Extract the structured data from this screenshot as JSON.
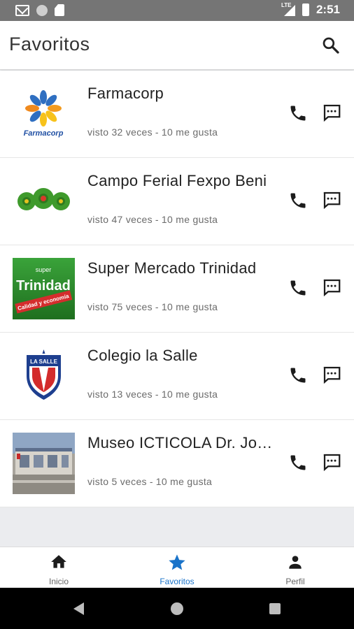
{
  "status_bar": {
    "time": "2:51",
    "network": "LTE"
  },
  "app_bar": {
    "title": "Favoritos"
  },
  "favorites": [
    {
      "name": "Farmacorp",
      "views": "visto 32 veces",
      "likes": "10 me gusta",
      "logo_text": "Farmacorp"
    },
    {
      "name": "Campo Ferial Fexpo Beni",
      "views": "visto 47 veces",
      "likes": "10 me gusta"
    },
    {
      "name": "Super Mercado Trinidad",
      "views": "visto 75 veces",
      "likes": "10 me gusta",
      "logo_text_1": "super",
      "logo_text_2": "Trinidad",
      "logo_text_3": "Calidad y economía"
    },
    {
      "name": "Colegio la Salle",
      "views": "visto 13 veces",
      "likes": "10 me gusta",
      "logo_text": "LA SALLE"
    },
    {
      "name": "Museo ICTICOLA Dr. Jorge",
      "views": "visto 5 veces",
      "likes": "10 me gusta"
    }
  ],
  "meta_separator": "-",
  "bottom_nav": {
    "items": [
      {
        "label": "Inicio",
        "icon": "home-icon"
      },
      {
        "label": "Favoritos",
        "icon": "star-icon",
        "active": true
      },
      {
        "label": "Perfil",
        "icon": "person-icon"
      }
    ]
  },
  "colors": {
    "accent": "#1a73c9",
    "status_bar": "#757575",
    "background": "#ebecef"
  }
}
